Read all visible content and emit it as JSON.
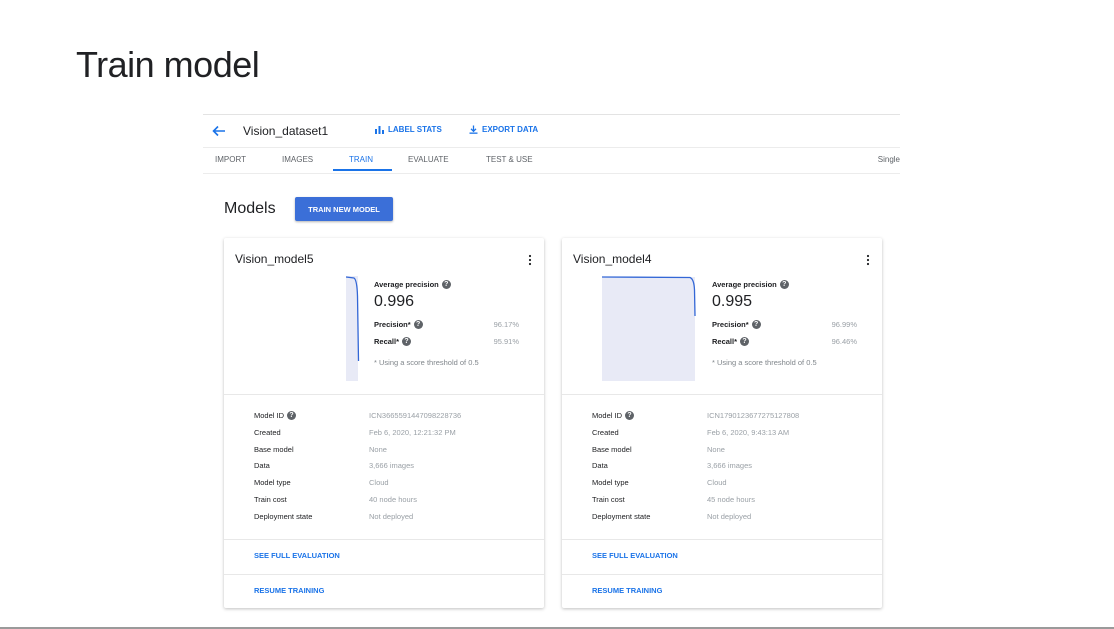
{
  "slide": {
    "title": "Train model"
  },
  "header": {
    "dataset_name": "Vision_dataset1",
    "label_stats": "LABEL STATS",
    "export_data": "EXPORT DATA"
  },
  "tabs": [
    {
      "label": "IMPORT"
    },
    {
      "label": "IMAGES"
    },
    {
      "label": "TRAIN"
    },
    {
      "label": "EVALUATE"
    },
    {
      "label": "TEST & USE"
    }
  ],
  "active_tab": "TRAIN",
  "single_label": "Single",
  "section": {
    "heading": "Models",
    "train_button": "TRAIN NEW MODEL"
  },
  "labels": {
    "average_precision": "Average precision",
    "precision": "Precision*",
    "recall": "Recall*",
    "threshold_note": "* Using a score threshold of 0.5",
    "model_id": "Model ID",
    "created": "Created",
    "base_model": "Base model",
    "data": "Data",
    "model_type": "Model type",
    "train_cost": "Train cost",
    "deployment_state": "Deployment state",
    "see_full_evaluation": "SEE FULL EVALUATION",
    "resume_training": "RESUME TRAINING"
  },
  "models": [
    {
      "name": "Vision_model5",
      "average_precision": "0.996",
      "precision": "96.17%",
      "recall": "95.91%",
      "model_id": "ICN3665591447098228736",
      "created": "Feb 6, 2020, 12:21:32 PM",
      "base_model": "None",
      "data": "3,666 images",
      "model_type": "Cloud",
      "train_cost": "40 node hours",
      "deployment_state": "Not deployed"
    },
    {
      "name": "Vision_model4",
      "average_precision": "0.995",
      "precision": "96.99%",
      "recall": "96.46%",
      "model_id": "ICN1790123677275127808",
      "created": "Feb 6, 2020, 9:43:13 AM",
      "base_model": "None",
      "data": "3,666 images",
      "model_type": "Cloud",
      "train_cost": "45 node hours",
      "deployment_state": "Not deployed"
    }
  ],
  "colors": {
    "accent": "#1a73e8",
    "button": "#3b6fd8",
    "chart_fill": "#e8eaf6",
    "chart_line": "#3367d6"
  },
  "icons": {
    "back": "arrow-left-icon",
    "label_stats": "bar-chart-icon",
    "export": "download-icon",
    "more": "more-vert-icon",
    "help": "help-icon"
  }
}
